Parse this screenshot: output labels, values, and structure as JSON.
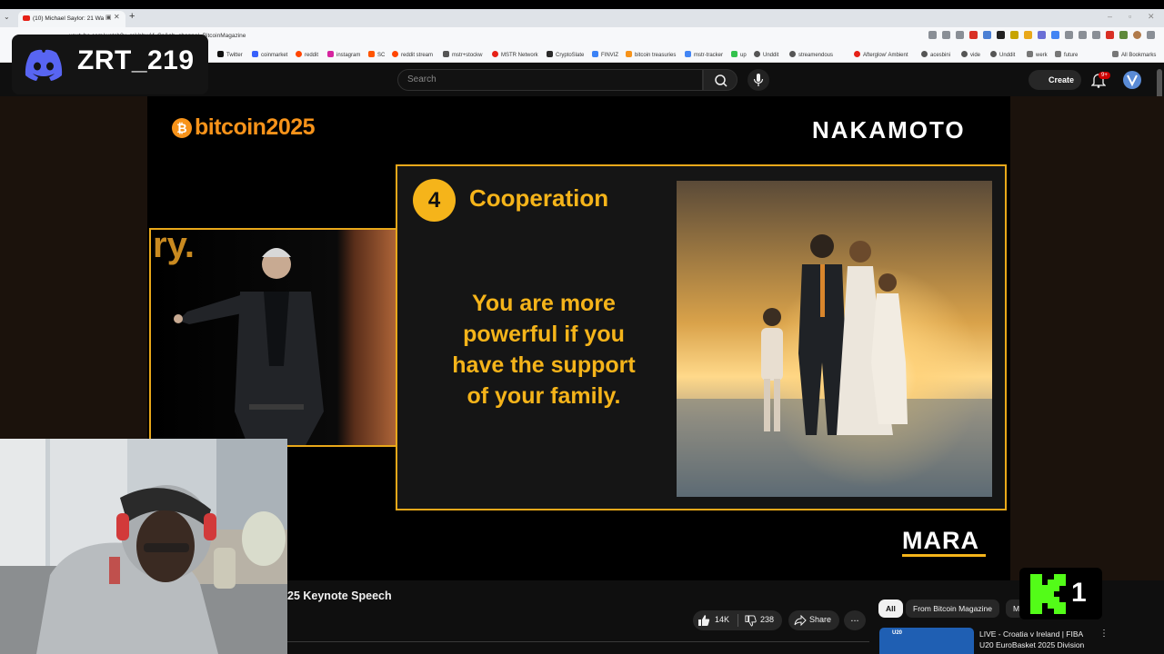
{
  "browser": {
    "tab_title": "(10) Michael Saylor: 21 Wa",
    "url": "youtube.com/watch?v=reVebuAf_Cs&ab_channel=BitcoinMagazine",
    "bookmarks": [
      "Twitter",
      "coinmarket",
      "reddit",
      "instagram",
      "SC",
      "reddit stream",
      "mstr+stockw",
      "MSTR Network",
      "CryptoSlate",
      "FINVIZ",
      "bitcoin treasuries",
      "mstr-tracker",
      "up",
      "Unddit",
      "streamendous",
      "Afterglow' Ambient",
      "acesbini",
      "vide",
      "Unddit",
      "werk",
      "future",
      "All Bookmarks"
    ],
    "bookmark_colors": [
      "#111111",
      "#3861fb",
      "#ff4500",
      "#d6249f",
      "#ff5500",
      "#ff4500",
      "#555555",
      "#e62117",
      "#2b2b2b",
      "#3b82f6",
      "#f7931a",
      "#4285f4",
      "#33c24d",
      "#555555",
      "#555555",
      "#e62117",
      "#555555",
      "#555555",
      "#555555",
      "#777777",
      "#777777",
      "#777777"
    ]
  },
  "youtube": {
    "search_placeholder": "Search",
    "create_label": "Create",
    "notif_badge": "9+",
    "video_title_partial": "25 Keynote Speech",
    "likes": "14K",
    "dislikes": "238",
    "share_label": "Share",
    "more_label": "...",
    "chips": [
      "All",
      "From Bitcoin Magazine",
      "M"
    ],
    "rec_title": "LIVE - Croatia v Ireland | FIBA U20 EuroBasket 2025 Division",
    "rec_thumb_text": "U20"
  },
  "slide": {
    "event_logo": "bitcoin2025",
    "sponsor_top": "NAKAMOTO",
    "number": "4",
    "title": "Cooperation",
    "body": "You are more\npowerful if you\nhave the support\nof your family.",
    "sponsor_bottom": "MARA",
    "speaker_bg_text": "ry."
  },
  "overlays": {
    "discord_name": "ZRT_219",
    "kick_number": "1"
  },
  "colors": {
    "bitcoin_orange": "#f7931a",
    "slide_gold": "#f5b41a",
    "youtube_bg": "#0f0f0f",
    "kick_green": "#53fc18",
    "discord_blurple": "#5865f2"
  }
}
